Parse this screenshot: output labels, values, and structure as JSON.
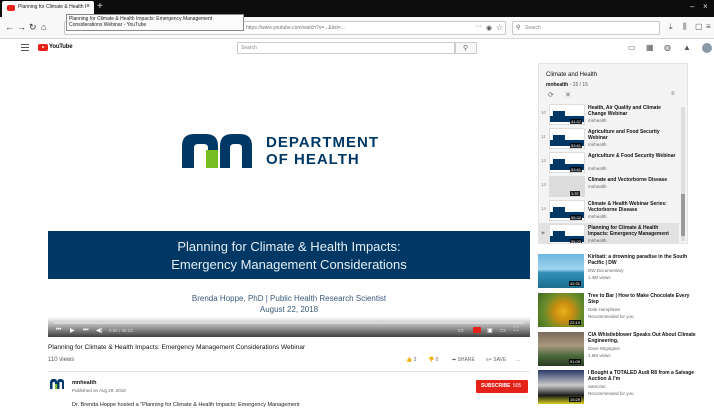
{
  "browser": {
    "tab_title": "Planning for Climate & Health I",
    "new_tab": "+",
    "tooltip": "Planning for Climate & Health Impacts: Emergency Management Considerations Webinar - YouTube",
    "url": "https://www.youtube.com/watch?v=...&list=...",
    "search_placeholder": "Search"
  },
  "youtube": {
    "logo_text": "YouTube",
    "search_placeholder": "Search"
  },
  "player": {
    "dept_line1": "DEPARTMENT",
    "dept_line2": "OF HEALTH",
    "slide_title_line1": "Planning for Climate & Health Impacts:",
    "slide_title_line2": "Emergency Management Considerations",
    "presenter": "Brenda Hoppe, PhD | Public Health Research Scientist",
    "date": "August 22, 2018",
    "time": "0:00 / 55:23",
    "progress": 0.0,
    "colors": {
      "brand_blue": "#003865",
      "mn_green": "#78be20",
      "yt_red": "#e62117"
    }
  },
  "video": {
    "title": "Planning for Climate & Health Impacts: Emergency Management Considerations Webinar",
    "views": "110 views",
    "likes": "3",
    "dislikes": "0",
    "share": "SHARE",
    "save": "SAVE",
    "more": "...",
    "channel": "mnhealth",
    "published": "Published on Aug 29, 2018",
    "subscribe": "SUBSCRIBE",
    "subscribers": "505",
    "description": "Dr. Brenda Hoppe hosted a \"Planning for Climate & Health Impacts: Emergency Management"
  },
  "playlist": {
    "title": "Climate and Health",
    "channel": "mnhealth",
    "position": "- 15 / 15",
    "items": [
      {
        "num": "10",
        "title": "Health, Air Quality and Climate Change Webinar",
        "channel": "mnhealth",
        "duration": "41:37"
      },
      {
        "num": "11",
        "title": "Agriculture and Food Security Webinar",
        "channel": "mnhealth",
        "duration": "53:41"
      },
      {
        "num": "12",
        "title": "Agriculture & Food Security Webinar",
        "channel": "mnhealth",
        "duration": "53:41"
      },
      {
        "num": "13",
        "title": "Climate and Vectorborne Disease",
        "channel": "mnhealth",
        "duration": "1:37"
      },
      {
        "num": "14",
        "title": "Climate & Health Webinar Series: Vectorborne Disease",
        "channel": "mnhealth",
        "duration": "55:32"
      },
      {
        "num": "▶",
        "title": "Planning for Climate & Health Impacts: Emergency Management",
        "channel": "mnhealth",
        "duration": "55:23"
      }
    ]
  },
  "recommendations": [
    {
      "title": "Kiribati: a drowning paradise in the South Pacific | DW",
      "channel": "DW Documentary",
      "meta": "1.4M views",
      "duration": "42:31"
    },
    {
      "title": "Tree to Bar | How to Make Chocolate Every Step",
      "channel": "Dale Humphries",
      "meta": "Recommended for you",
      "duration": "22:19"
    },
    {
      "title": "CIA Whistleblower Speaks Out About Climate Engineering,",
      "channel": "Dane Wigington",
      "meta": "1.5M views",
      "duration": "51:09"
    },
    {
      "title": "I Bought a TOTALED Audi R8 from a Salvage Auction & I'm",
      "channel": "Samcrac",
      "meta": "Recommended for you",
      "duration": "15:29"
    }
  ]
}
